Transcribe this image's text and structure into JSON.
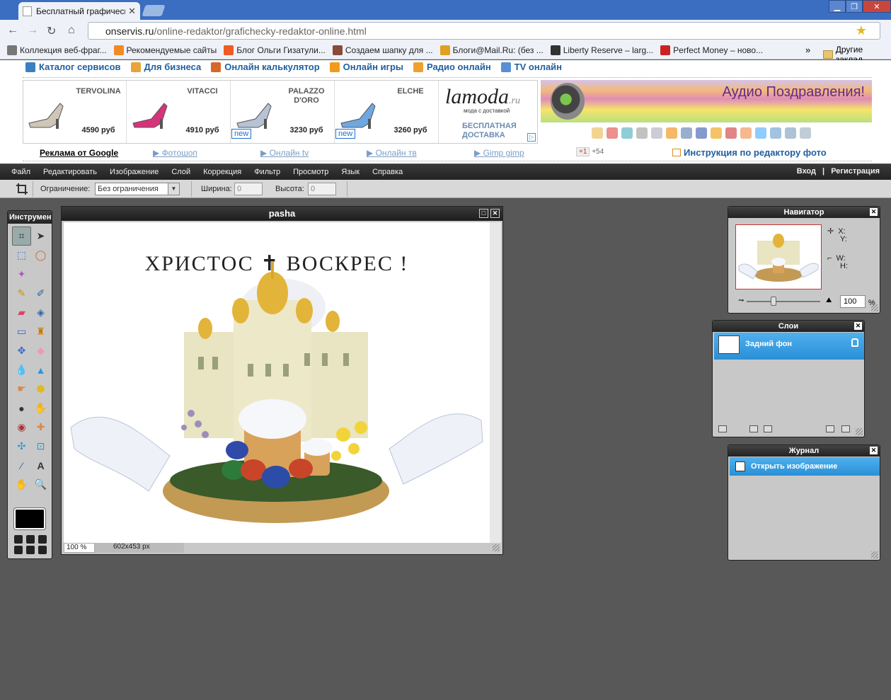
{
  "browser": {
    "tab_title": "Бесплатный графический р",
    "url_domain": "onservis.ru",
    "url_path": "/online-redaktor/grafichecky-redaktor-online.html",
    "bookmarks": [
      {
        "label": "Коллекция веб-фраг...",
        "color": "#777777"
      },
      {
        "label": "Рекомендуемые сайты",
        "color": "#f08a24"
      },
      {
        "label": "Блог Ольги Гизатули...",
        "color": "#f05a24"
      },
      {
        "label": "Создаем шапку для ...",
        "color": "#8a4a3a"
      },
      {
        "label": "Блоги@Mail.Ru: (без ...",
        "color": "#e0a020"
      },
      {
        "label": "Liberty Reserve – larg...",
        "color": "#333333"
      },
      {
        "label": "Perfect Money – ново...",
        "color": "#cc2222"
      }
    ],
    "bookmarks_more": "»",
    "other_bookmarks": "Другие заклад"
  },
  "site": {
    "nav": [
      {
        "label": "Каталог сервисов",
        "color": "#3a7fc1"
      },
      {
        "label": "Для бизнеса",
        "color": "#e8a33a"
      },
      {
        "label": "Онлайн калькулятор",
        "color": "#d8672a"
      },
      {
        "label": "Онлайн игры",
        "color": "#f29b1a"
      },
      {
        "label": "Радио онлайн",
        "color": "#f0a030"
      },
      {
        "label": "TV онлайн",
        "color": "#5a8fd6"
      }
    ],
    "ad_shoes": [
      {
        "name": "TERVOLINA",
        "price": "4590 руб",
        "new": ""
      },
      {
        "name": "VITACCI",
        "price": "4910 руб",
        "new": ""
      },
      {
        "name": "PALAZZO D'ORO",
        "price": "3230 руб",
        "new": "new"
      },
      {
        "name": "ELCHE",
        "price": "3260 руб",
        "new": "new"
      }
    ],
    "lamoda_logo": "lamoda",
    "lamoda_tld": ".ru",
    "lamoda_tagline": "мода с доставкой",
    "lamoda_free": "БЕСПЛАТНАЯ ДОСТАВКА",
    "audio_banner": "Аудио Поздравления!",
    "google_ads": "Реклама от Google",
    "links": [
      "▶ Фотошоп",
      "▶ Онлайн tv",
      "▶ Онлайн тв",
      "▶ Gimp gimp"
    ],
    "gplus": "+1",
    "gplus_count": "+54",
    "instruction": "Инструкция по редактору фото"
  },
  "editor": {
    "menu": [
      "Файл",
      "Редактировать",
      "Изображение",
      "Слой",
      "Коррекция",
      "Фильтр",
      "Просмотр",
      "Язык",
      "Справка"
    ],
    "login": "Вход",
    "separator": "|",
    "register": "Регистрация",
    "options": {
      "limit_label": "Ограничение:",
      "limit_value": "Без ограничения",
      "width_label": "Ширина:",
      "width_value": "0",
      "height_label": "Высота:",
      "height_value": "0"
    },
    "tools_title": "Инструменты",
    "image_window": {
      "title": "pasha",
      "zoom": "100 %",
      "dims": "602x453 px",
      "card_text": "ХРИСТОС ✝ ВОСКРЕС !"
    },
    "navigator": {
      "title": "Навигатор",
      "x_label": "X:",
      "y_label": "Y:",
      "w_label": "W:",
      "h_label": "H:",
      "zoom": "100",
      "pct": "%"
    },
    "layers": {
      "title": "Слои",
      "layer_name": "Задний фон"
    },
    "history": {
      "title": "Журнал",
      "item": "Открыть изображение"
    }
  }
}
